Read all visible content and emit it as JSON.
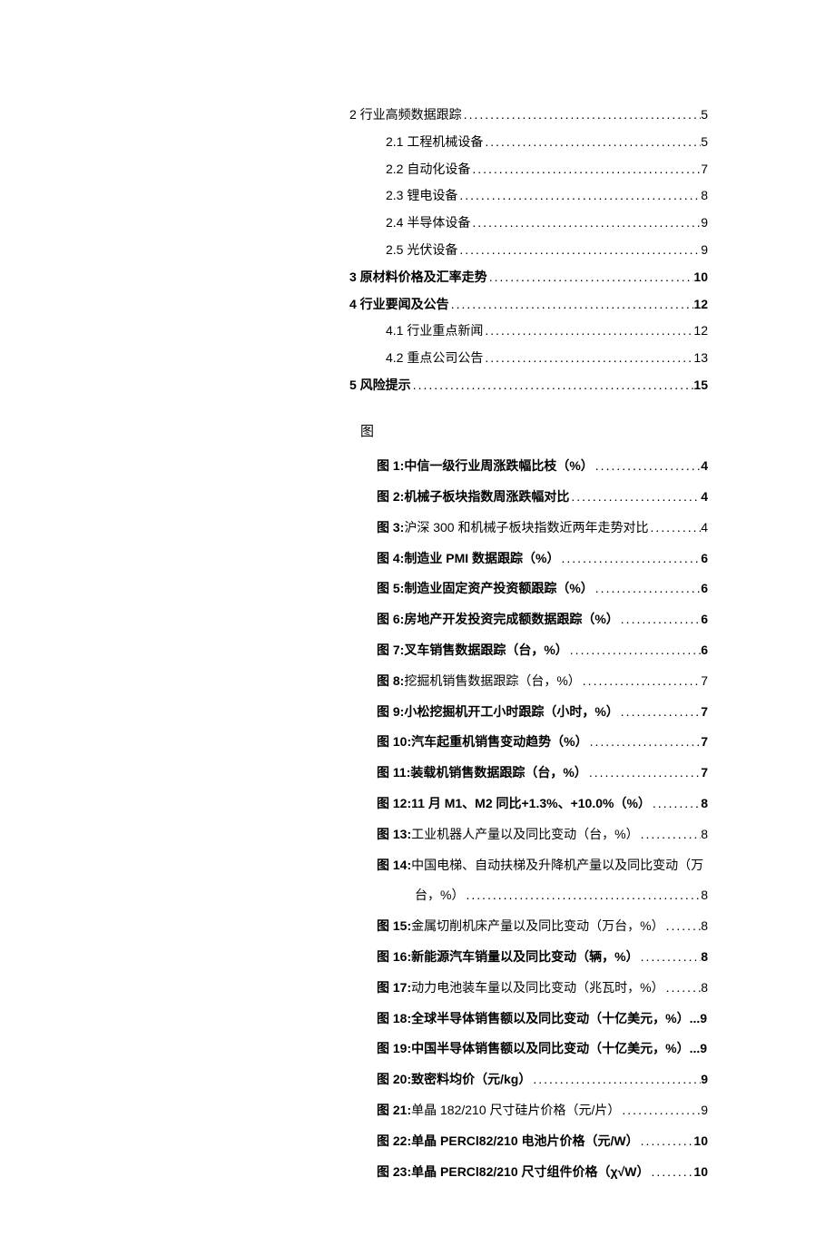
{
  "toc": [
    {
      "label": "2 行业高频数据跟踪",
      "page": "5",
      "bold": false,
      "indent": 0
    },
    {
      "label": "2.1  工程机械设备",
      "page": "5",
      "bold": false,
      "indent": 1
    },
    {
      "label": "2.2  自动化设备",
      "page": "7",
      "bold": false,
      "indent": 1
    },
    {
      "label": "2.3  锂电设备",
      "page": "8",
      "bold": false,
      "indent": 1
    },
    {
      "label": "2.4  半导体设备",
      "page": "9",
      "bold": false,
      "indent": 1
    },
    {
      "label": "2.5  光伏设备",
      "page": "9",
      "bold": false,
      "indent": 1
    },
    {
      "label": "3 原材料价格及汇率走势",
      "page": "10",
      "bold": true,
      "indent": 0
    },
    {
      "label": "4 行业要闻及公告",
      "page": "12",
      "bold": true,
      "indent": 0
    },
    {
      "label": "4.1 行业重点新闻",
      "page": "12",
      "bold": false,
      "indent": 1
    },
    {
      "label": "4.2 重点公司公告",
      "page": "13",
      "bold": false,
      "indent": 1
    },
    {
      "label": "5 风险提示",
      "page": "15",
      "bold": true,
      "indent": 0
    }
  ],
  "figures_heading": "图",
  "figures": [
    {
      "prefix": "图 1:",
      "title": "中信一级行业周涨跌幅比枝（%）",
      "page": "4",
      "bold_title": true
    },
    {
      "prefix": "图 2:",
      "title": "机械子板块指数周涨跌幅对比",
      "page": "4",
      "bold_title": true
    },
    {
      "prefix": "图 3:",
      "title": "沪深 300 和机械子板块指数近两年走势对比",
      "page": "4",
      "bold_title": false
    },
    {
      "prefix": "图 4:",
      "title": "制造业 PMI 数据跟踪（%）",
      "page": "6",
      "bold_title": true
    },
    {
      "prefix": "图 5:",
      "title": "制造业固定资产投资额跟踪（%）",
      "page": "6",
      "bold_title": true
    },
    {
      "prefix": "图 6:",
      "title": "房地产开发投资完成额数据跟踪（%）",
      "page": "6",
      "bold_title": true
    },
    {
      "prefix": "图 7:",
      "title": "叉车销售数据跟踪（台，%）",
      "page": "6",
      "bold_title": true
    },
    {
      "prefix": "图 8:",
      "title": "挖掘机销售数据跟踪（台，%）",
      "page": "7",
      "bold_title": false
    },
    {
      "prefix": "图 9:",
      "title": "小松挖掘机开工小时跟踪（小时，%）",
      "page": "7",
      "bold_title": true
    },
    {
      "prefix": "图 10:",
      "title": "汽车起重机销售变动趋势（%）",
      "page": "7",
      "bold_title": true
    },
    {
      "prefix": "图 11:",
      "title": "装载机销售数据跟踪（台，%）",
      "page": "7",
      "bold_title": true
    },
    {
      "prefix": "图 12:",
      "title": "11 月 M1、M2 同比+1.3%、+10.0%（%）",
      "page": "8",
      "bold_title": true
    },
    {
      "prefix": "图 13:",
      "title": "工业机器人产量以及同比变动（台，%）",
      "page": "8",
      "bold_title": false
    },
    {
      "prefix": "图 14:",
      "title": "中国电梯、自动扶梯及升降机产量以及同比变动（万",
      "page": "",
      "bold_title": false,
      "wrap": true,
      "cont": "台，%）",
      "cont_page": "8"
    },
    {
      "prefix": "图 15:",
      "title": "金属切削机床产量以及同比变动（万台，%）",
      "page": "8",
      "bold_title": false
    },
    {
      "prefix": "图 16:",
      "title": "新能源汽车销量以及同比变动（辆，%）",
      "page": "8",
      "bold_title": true
    },
    {
      "prefix": "图 17:",
      "title": "动力电池装车量以及同比变动（兆瓦时，%）",
      "page": "8",
      "bold_title": false
    },
    {
      "prefix": "图 18:",
      "title": "全球半导体销售额以及同比变动（十亿美元，%）",
      "page": "...9",
      "bold_title": true,
      "nodots": true
    },
    {
      "prefix": "图 19:",
      "title": "中国半导体销售额以及同比变动（十亿美元，%）",
      "page": "...9",
      "bold_title": true,
      "nodots": true
    },
    {
      "prefix": "图 20:",
      "title": "致密料均价（元/kg）",
      "page": "9",
      "bold_title": true
    },
    {
      "prefix": "图 21:",
      "title": "单晶 182/210 尺寸硅片价格（元/片）",
      "page": "9",
      "bold_title": false
    },
    {
      "prefix": "图 22:",
      "title": "单晶 PERCl82/210 电池片价格（元/W）",
      "page": "10",
      "bold_title": true
    },
    {
      "prefix": "图 23:",
      "title": "单晶 PERCl82/210 尺寸组件价格（χ√W）",
      "page": "10",
      "bold_title": true
    }
  ]
}
